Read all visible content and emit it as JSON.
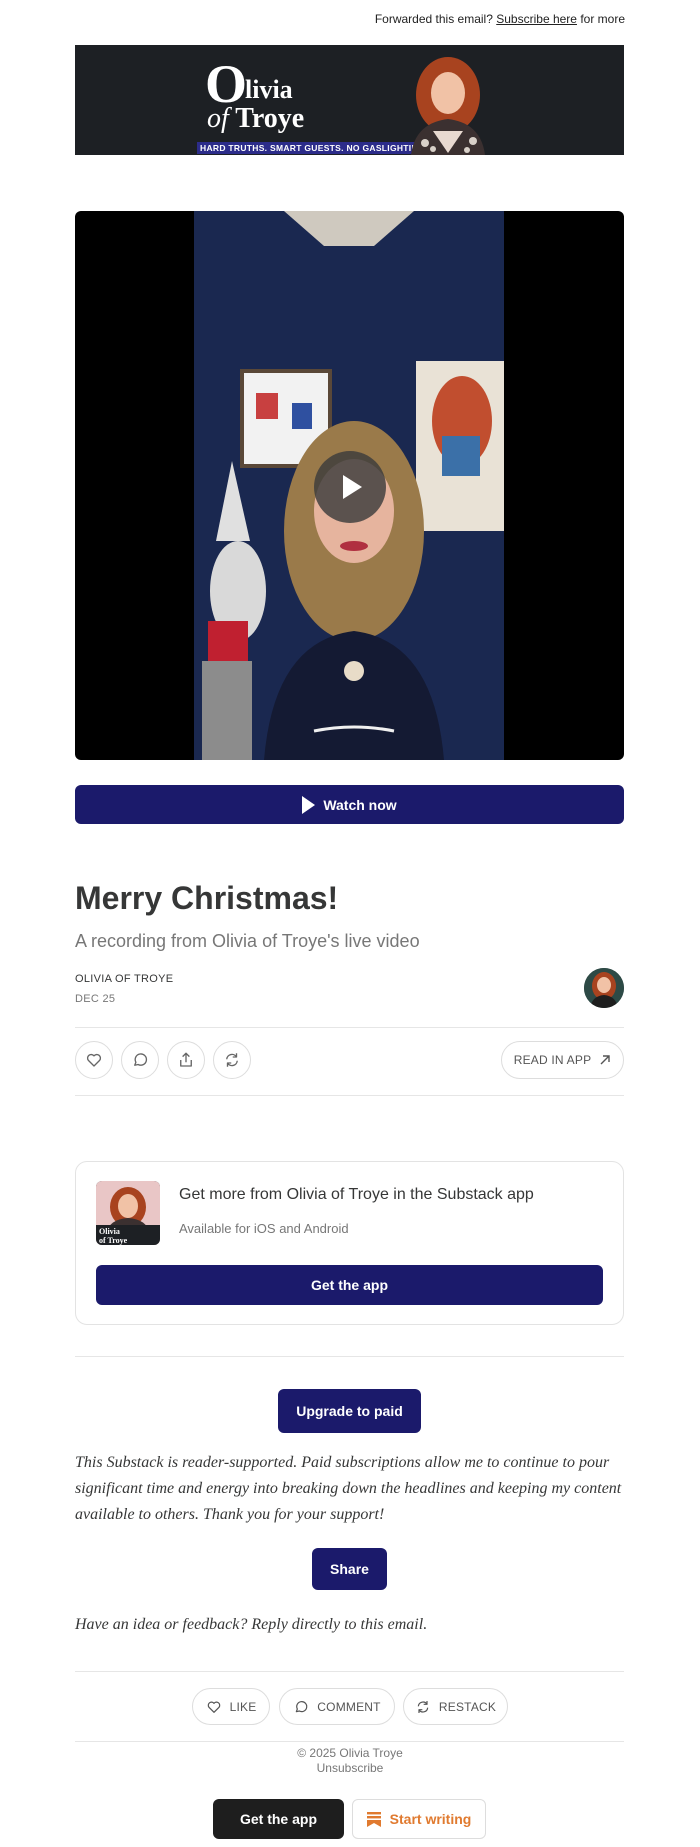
{
  "header": {
    "forwarded_prefix": "Forwarded this email?",
    "subscribe_link": "Subscribe here",
    "forwarded_suffix": "for more"
  },
  "banner": {
    "logo_big_letter": "O",
    "logo_line1": "livia",
    "logo_line2_of": "of",
    "logo_line2_name": "Troye",
    "tagline": "HARD TRUTHS. SMART GUESTS. NO GASLIGHTING."
  },
  "video": {
    "watch_label": "Watch now"
  },
  "post": {
    "title": "Merry Christmas!",
    "subtitle": "A recording from Olivia of Troye's live video",
    "author": "OLIVIA OF TROYE",
    "date": "DEC 25"
  },
  "actions": {
    "read_in_app": "READ IN APP"
  },
  "app_promo": {
    "title": "Get more from Olivia of Troye in the Substack app",
    "subtitle": "Available for iOS and Android",
    "button": "Get the app",
    "thumb_logo_line1": "Olivia",
    "thumb_logo_line2": "of Troye"
  },
  "support": {
    "upgrade_button": "Upgrade to paid",
    "message": "This Substack is reader-supported. Paid subscriptions allow me to continue to pour significant time and energy into breaking down the headlines and keeping my content available to others. Thank you for your support!",
    "share_button": "Share",
    "feedback": "Have an idea or feedback? Reply directly to this email."
  },
  "engagement": {
    "like": "LIKE",
    "comment": "COMMENT",
    "restack": "RESTACK"
  },
  "footer": {
    "copyright": "© 2025 Olivia Troye",
    "unsubscribe": "Unsubscribe",
    "get_app": "Get the app",
    "start_writing": "Start writing"
  },
  "colors": {
    "accent": "#1b1a6b",
    "start_writing": "#e07a2f"
  }
}
